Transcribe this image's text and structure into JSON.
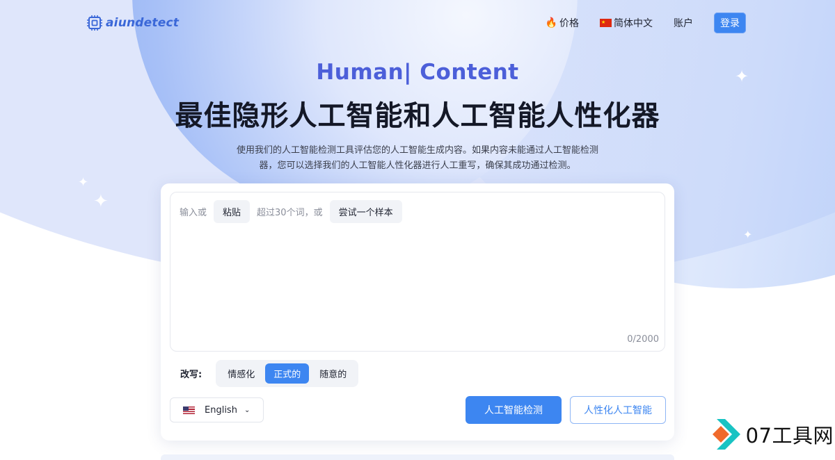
{
  "brand": {
    "name": "aiundetect"
  },
  "nav": {
    "pricing_icon": "fire-icon",
    "pricing": "价格",
    "language": "简体中文",
    "account": "账户",
    "login": "登录"
  },
  "hero": {
    "subtitle": "Human| Content",
    "title": "最佳隐形人工智能和人工智能人性化器",
    "description": "使用我们的人工智能检测工具评估您的人工智能生成内容。如果内容未能通过人工智能检测器，您可以选择我们的人工智能人性化器进行人工重写，确保其成功通过检测。"
  },
  "editor": {
    "hint_prefix": "输入或",
    "paste": "粘贴",
    "hint_middle": "超过30个词，或",
    "try_sample": "尝试一个样本",
    "counter": "0/2000"
  },
  "rewrite": {
    "label": "改写:",
    "options": [
      "情感化",
      "正式的",
      "随意的"
    ],
    "selected": "正式的"
  },
  "language_select": {
    "value": "English"
  },
  "actions": {
    "detect": "人工智能检测",
    "humanize": "人性化人工智能"
  },
  "watermark": {
    "text": "07工具网"
  },
  "colors": {
    "accent": "#3d86f1",
    "brand": "#3a67d8",
    "subtitle": "#4c5fd9"
  }
}
